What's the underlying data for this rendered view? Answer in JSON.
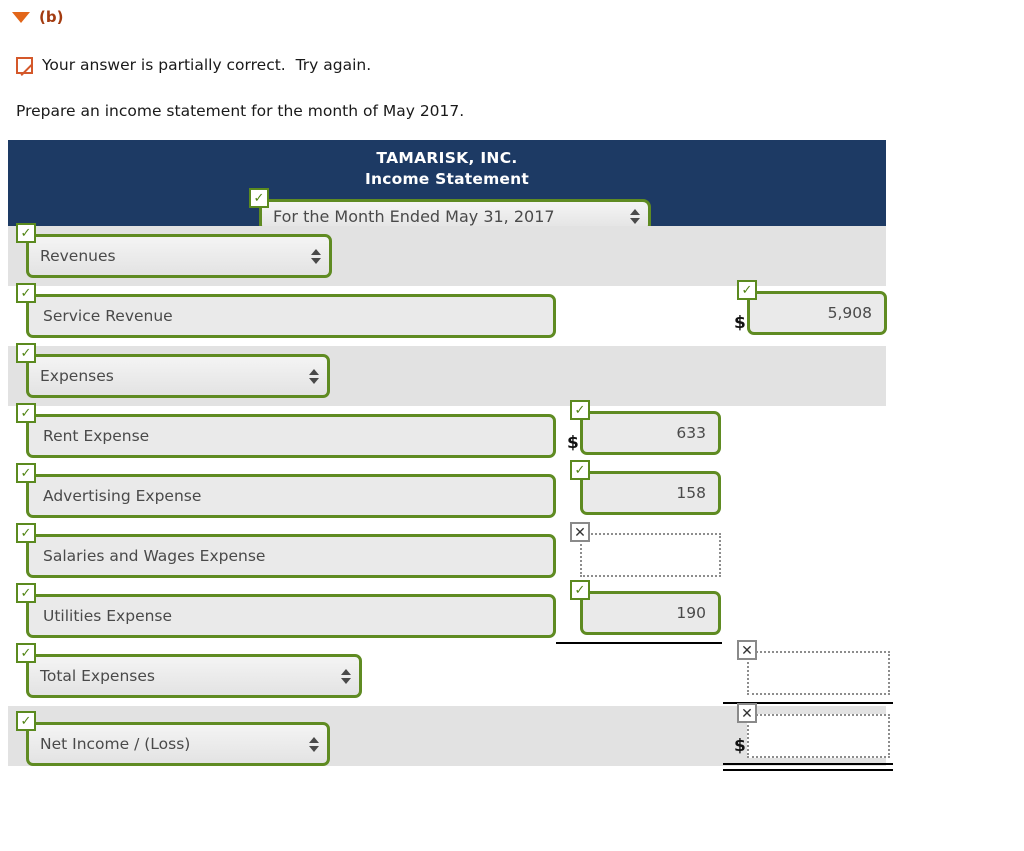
{
  "question": {
    "part_label": "(b)",
    "collapse_icon": "triangle-down-icon",
    "feedback_icon": "partially-correct-icon",
    "feedback_text": "Your answer is partially correct.  Try again.",
    "instruction": "Prepare an income statement for the month of May 2017."
  },
  "statement": {
    "company_name": "TAMARISK, INC.",
    "statement_title": "Income Statement",
    "period_select": {
      "value": "For the Month Ended May 31, 2017",
      "status": "correct"
    },
    "rows": [
      {
        "id": "revenues-header",
        "band": "gray",
        "label_type": "select",
        "label": "Revenues",
        "label_status": "correct",
        "amount": null
      },
      {
        "id": "service-revenue",
        "band": "white",
        "label_type": "text",
        "label": "Service Revenue",
        "label_status": "correct",
        "amount": "5,908",
        "amount_status": "correct",
        "amount_column": "right",
        "dollar_sign": "$"
      },
      {
        "id": "expenses-header",
        "band": "gray",
        "label_type": "select",
        "label": "Expenses",
        "label_status": "correct",
        "amount": null
      },
      {
        "id": "rent-expense",
        "band": "white",
        "label_type": "text",
        "label": "Rent Expense",
        "label_status": "correct",
        "amount": "633",
        "amount_status": "correct",
        "amount_column": "left",
        "dollar_sign": "$"
      },
      {
        "id": "advertising-expense",
        "band": "white",
        "label_type": "text",
        "label": "Advertising Expense",
        "label_status": "correct",
        "amount": "158",
        "amount_status": "correct",
        "amount_column": "left",
        "dollar_sign": ""
      },
      {
        "id": "salaries-and-wages-expense",
        "band": "white",
        "label_type": "text",
        "label": "Salaries and Wages Expense",
        "label_status": "correct",
        "amount": "",
        "amount_status": "incorrect",
        "amount_column": "left",
        "dollar_sign": ""
      },
      {
        "id": "utilities-expense",
        "band": "white",
        "label_type": "text",
        "label": "Utilities Expense",
        "label_status": "correct",
        "amount": "190",
        "amount_status": "correct",
        "amount_column": "left",
        "dollar_sign": ""
      },
      {
        "id": "total-expenses",
        "band": "white",
        "label_type": "select",
        "label": "Total Expenses",
        "label_status": "correct",
        "amount": "",
        "amount_status": "incorrect",
        "amount_column": "right",
        "dollar_sign": ""
      },
      {
        "id": "net-income-loss",
        "band": "gray",
        "label_type": "select",
        "label": "Net Income / (Loss)",
        "label_status": "correct",
        "amount": "",
        "amount_status": "incorrect",
        "amount_column": "right",
        "dollar_sign": "$"
      }
    ],
    "badges": {
      "correct_glyph": "✓",
      "incorrect_glyph": "✕"
    },
    "colors": {
      "header_navy": "#1d3a64",
      "correct_green": "#5f8b22",
      "incorrect_gray": "#8a8a8a",
      "part_label_orange": "#a33b10",
      "band_gray": "#e2e2e2"
    }
  }
}
